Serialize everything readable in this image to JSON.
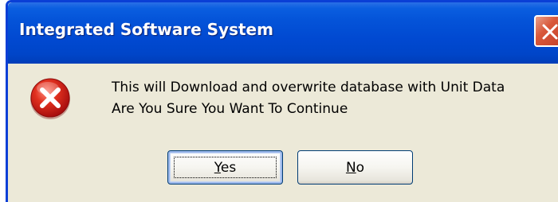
{
  "window": {
    "title": "Integrated Software System"
  },
  "message": {
    "line1": "This will Download and overwrite database with Unit Data",
    "line2": "Are You Sure You Want To Continue"
  },
  "buttons": {
    "yes": {
      "mnemonic": "Y",
      "rest": "es"
    },
    "no": {
      "mnemonic": "N",
      "rest": "o"
    }
  },
  "icons": {
    "close": "close-icon",
    "error": "error-icon"
  },
  "colors": {
    "titlebar": "#0453d8",
    "window_bg": "#ece9d8",
    "error_red": "#d81e1e",
    "close_red": "#d8583a"
  }
}
